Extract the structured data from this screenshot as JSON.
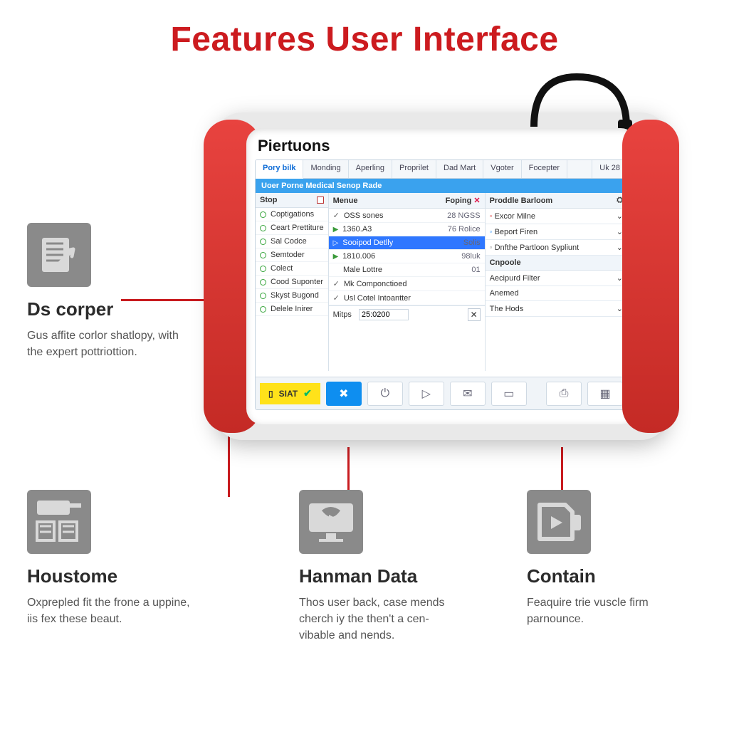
{
  "page_title": "Features User Interface",
  "brand": "Piertuons",
  "tabs": [
    "Pory bilk",
    "Monding",
    "Aperling",
    "Proprilet",
    "Dad Mart",
    "Vgoter",
    "Focepter"
  ],
  "tab_right": "Uk 28",
  "banner": "Uoer Porne Medical Senop Rade",
  "sidebar": {
    "header": "Stop",
    "items": [
      "Coptigations",
      "Ceart Prettiture",
      "Sal Codce",
      "Semtoder",
      "Colect",
      "Cood Suponter",
      "Skyst Bugond",
      "Delele Inirer"
    ]
  },
  "mid": {
    "head_left": "Menue",
    "head_right": "Foping",
    "rows": [
      {
        "k": "OSS sones",
        "v": "28 NGSS",
        "mark": "chk"
      },
      {
        "k": "1360.A3",
        "v": "76 Rolice",
        "mark": "tri"
      },
      {
        "k": "Sooipod Detlly",
        "v": "Solis",
        "mark": "selected"
      },
      {
        "k": "1810.006",
        "v": "98luk",
        "mark": "tri"
      },
      {
        "k": "Male Lottre",
        "v": "01",
        "mark": "none"
      },
      {
        "k": "Mk Componctioed",
        "v": "",
        "mark": "chk"
      },
      {
        "k": "Usl Cotel Intoantter",
        "v": "",
        "mark": "chk"
      }
    ],
    "mbar_label": "Mitps",
    "mbar_value": "25:0200"
  },
  "right": {
    "section1_head": "Proddle Barloom",
    "section1_items": [
      "Excor Milne",
      "Beport Firen",
      "Dnfthe Partloon Sypliunt"
    ],
    "section2_head": "Cnpoole",
    "section2_items": [
      "Aecipurd Filter",
      "Anemed",
      "The Hods"
    ]
  },
  "status_label": "SIAT",
  "callouts": {
    "c1": {
      "title": "Ds corper",
      "body": "Gus affite corlor shatlopy, with the expert pottriottion."
    },
    "c2": {
      "title": "Houstome",
      "body": "Oxprepled fit the frone a uppine, iis fex these beaut."
    },
    "c3": {
      "title": "Hanman Data",
      "body": "Thos user back, case mends cherch iy the then't a cen-vibable and nends."
    },
    "c4": {
      "title": "Contain",
      "body": "Feaquire trie vuscle firm parnounce."
    }
  }
}
